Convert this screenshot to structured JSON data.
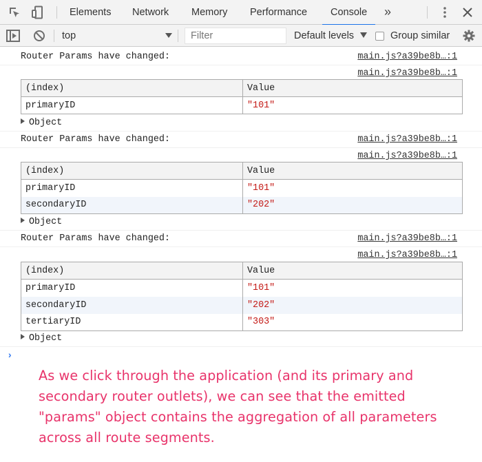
{
  "tabs": {
    "elements": "Elements",
    "network": "Network",
    "memory": "Memory",
    "performance": "Performance",
    "console": "Console",
    "more": "»"
  },
  "toolbar": {
    "context": "top",
    "filter_placeholder": "Filter",
    "levels": "Default levels",
    "group_similar": "Group similar"
  },
  "logs": [
    {
      "message": "Router Params have changed:",
      "source": "main.js?a39be8b…:1",
      "table_source": "main.js?a39be8b…:1",
      "headers": [
        "(index)",
        "Value"
      ],
      "rows": [
        {
          "index": "primaryID",
          "value": "\"101\""
        }
      ],
      "object": "Object"
    },
    {
      "message": "Router Params have changed:",
      "source": "main.js?a39be8b…:1",
      "table_source": "main.js?a39be8b…:1",
      "headers": [
        "(index)",
        "Value"
      ],
      "rows": [
        {
          "index": "primaryID",
          "value": "\"101\""
        },
        {
          "index": "secondaryID",
          "value": "\"202\""
        }
      ],
      "object": "Object"
    },
    {
      "message": "Router Params have changed:",
      "source": "main.js?a39be8b…:1",
      "table_source": "main.js?a39be8b…:1",
      "headers": [
        "(index)",
        "Value"
      ],
      "rows": [
        {
          "index": "primaryID",
          "value": "\"101\""
        },
        {
          "index": "secondaryID",
          "value": "\"202\""
        },
        {
          "index": "tertiaryID",
          "value": "\"303\""
        }
      ],
      "object": "Object"
    }
  ],
  "prompt": "›",
  "annotation": "As we click through the application (and its primary and secondary router outlets), we can see that the emitted \"params\" object contains the aggregation of all parameters across all route segments.",
  "colors": {
    "accent": "#1a73e8",
    "string_value": "#c41a16",
    "annotation": "#e8336a",
    "prompt": "#367cf1"
  }
}
